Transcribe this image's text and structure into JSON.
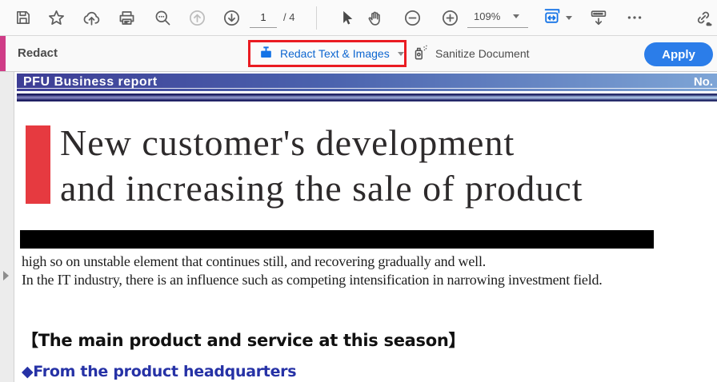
{
  "toolbar": {
    "page_current": "1",
    "page_total": "/ 4",
    "zoom_level": "109%"
  },
  "redact_bar": {
    "title": "Redact",
    "redact_button": "Redact Text & Images",
    "sanitize_button": "Sanitize Document",
    "apply_button": "Apply"
  },
  "document": {
    "header_title": "PFU Business report",
    "header_no": "No.",
    "title_line1": "New customer's development",
    "title_line2": "and increasing the sale of product",
    "body_line1": "high so on unstable element that continues still, and recovering gradually and well.",
    "body_line2": "In the IT industry, there is an influence such as competing intensification in narrowing investment field.",
    "section_heading": "【The main product and service at this season】",
    "bullet_line": "◆From the product headquarters"
  },
  "colors": {
    "accent_magenta": "#cf3c87",
    "highlight_red": "#ea1c22",
    "adobe_blue": "#1473e6",
    "button_label_blue": "#0d66d0",
    "apply_blue": "#2b7de9",
    "header_gradient_left": "#3d3d95",
    "header_gradient_right": "#7ea5d6",
    "title_red_rect": "#e63a40",
    "bullet_blue": "#2632a6"
  },
  "icons": {
    "save": "floppy-disk",
    "star": "star-outline",
    "share": "cloud-upload-arrow",
    "print": "printer",
    "find": "magnifier-with-dots",
    "page_up": "circle-arrow-up-disabled",
    "page_down": "circle-arrow-down",
    "select": "cursor-arrow",
    "hand": "hand-pan",
    "zoom_out": "circle-minus",
    "zoom_in": "circle-plus",
    "fit_width": "page-fit-width-blue",
    "dock_toolbar": "toolbar-strip-down-arrow",
    "more": "ellipsis",
    "share_link": "chain-link-cloud",
    "redact_tool": "blue-box-with-T",
    "sanitize": "spray-bottle",
    "nav_expand": "right-triangle"
  }
}
